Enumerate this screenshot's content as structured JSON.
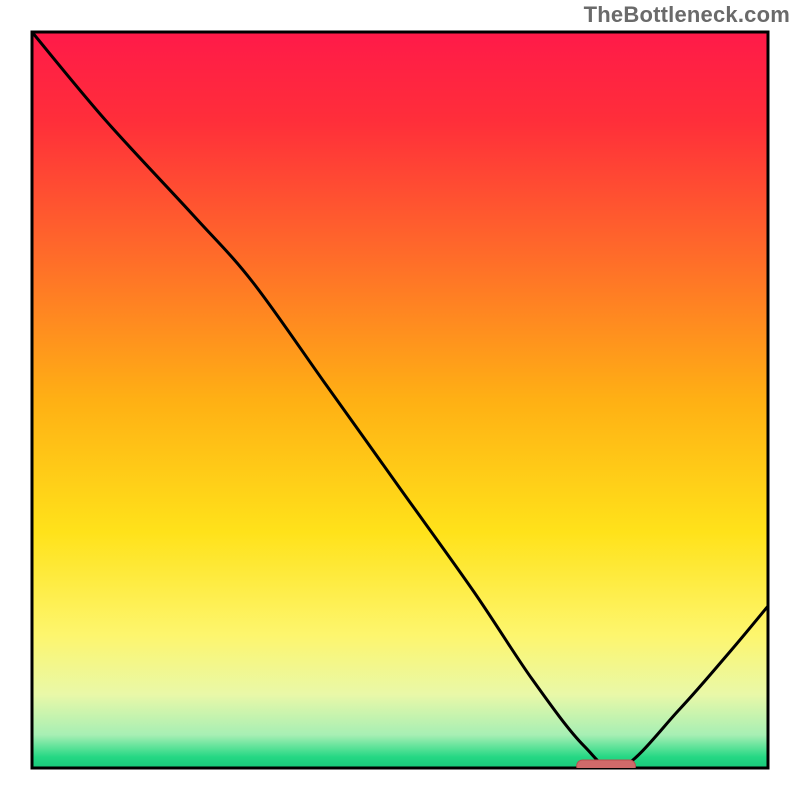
{
  "watermark": "TheBottleneck.com",
  "colors": {
    "frame": "#000000",
    "curve": "#000000",
    "marker_fill": "#cf6a6a",
    "marker_stroke": "#b84f4f",
    "gradient_stops": [
      {
        "offset": 0.0,
        "color": "#ff1a49"
      },
      {
        "offset": 0.12,
        "color": "#ff2e3a"
      },
      {
        "offset": 0.3,
        "color": "#ff6a2a"
      },
      {
        "offset": 0.5,
        "color": "#ffb014"
      },
      {
        "offset": 0.68,
        "color": "#ffe21a"
      },
      {
        "offset": 0.82,
        "color": "#fdf66e"
      },
      {
        "offset": 0.9,
        "color": "#e9f8a8"
      },
      {
        "offset": 0.955,
        "color": "#a7efb4"
      },
      {
        "offset": 0.985,
        "color": "#25d884"
      },
      {
        "offset": 1.0,
        "color": "#18c97a"
      }
    ]
  },
  "chart_data": {
    "type": "line",
    "title": "",
    "xlabel": "",
    "ylabel": "",
    "xlim": [
      0,
      100
    ],
    "ylim": [
      0,
      100
    ],
    "grid": false,
    "legend": false,
    "annotations": [
      "TheBottleneck.com"
    ],
    "x": [
      0,
      10,
      22,
      30,
      40,
      50,
      60,
      68,
      75,
      80,
      88,
      95,
      100
    ],
    "values": [
      100,
      88,
      75,
      66,
      52,
      38,
      24,
      12,
      3,
      0,
      8,
      16,
      22
    ],
    "optimal_marker": {
      "x_start": 74,
      "x_end": 82,
      "y": 0
    }
  }
}
